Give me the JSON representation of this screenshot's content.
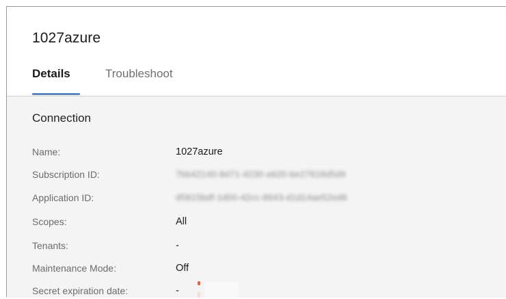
{
  "header": {
    "title": "1027azure"
  },
  "tabs": [
    {
      "label": "Details",
      "active": true
    },
    {
      "label": "Troubleshoot",
      "active": false
    }
  ],
  "section": {
    "title": "Connection",
    "fields": [
      {
        "label": "Name:",
        "value": "1027azure"
      },
      {
        "label": "Subscription ID:",
        "value": "7bb42140-8d71-4230-a920-be27818d5d9"
      },
      {
        "label": "Application ID:",
        "value": "d5815bdf-1d00-42cc-8643-d1d14ae52ed6"
      },
      {
        "label": "Scopes:",
        "value": "All"
      },
      {
        "label": "Tenants:",
        "value": "-"
      },
      {
        "label": "Maintenance Mode:",
        "value": "Off"
      },
      {
        "label": "Secret expiration date:",
        "value": "-"
      }
    ]
  },
  "colors": {
    "accent": "#5b87c1",
    "content_bg": "#f4f4f4",
    "warning": "#e0603a"
  },
  "icons": {
    "secret_expiration": "warning-icon"
  }
}
